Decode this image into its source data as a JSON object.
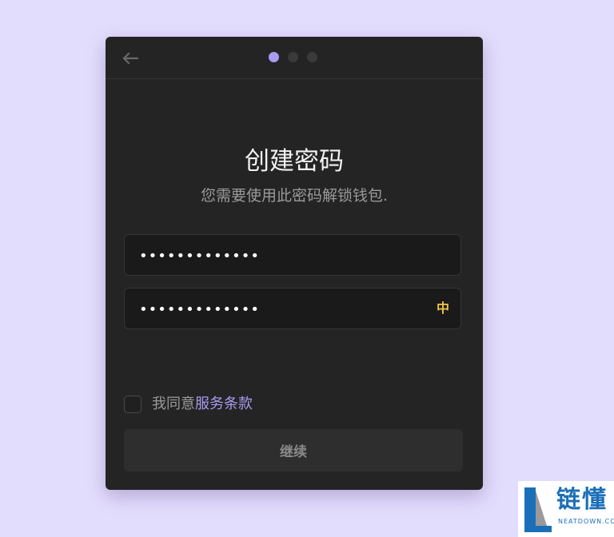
{
  "header": {
    "back_icon": "arrow-left-icon",
    "steps_total": 3,
    "step_active": 1
  },
  "main": {
    "title": "创建密码",
    "subtitle": "您需要使用此密码解锁钱包."
  },
  "password_field": {
    "value": "•••••••••••••"
  },
  "confirm_field": {
    "value": "•••••••••••••",
    "strength_label": "中"
  },
  "agreement": {
    "prefix": "我同意",
    "link": "服务条款",
    "checked": false
  },
  "continue_button": {
    "label": "继续"
  },
  "watermark": {
    "logo_letter": "L",
    "brand": "链懂",
    "site": "NEATDOWN.COM"
  },
  "colors": {
    "page_background": "#e3ddfd",
    "card_background": "#242424",
    "accent": "#a99bf0",
    "strength_medium": "#f0c24a"
  }
}
